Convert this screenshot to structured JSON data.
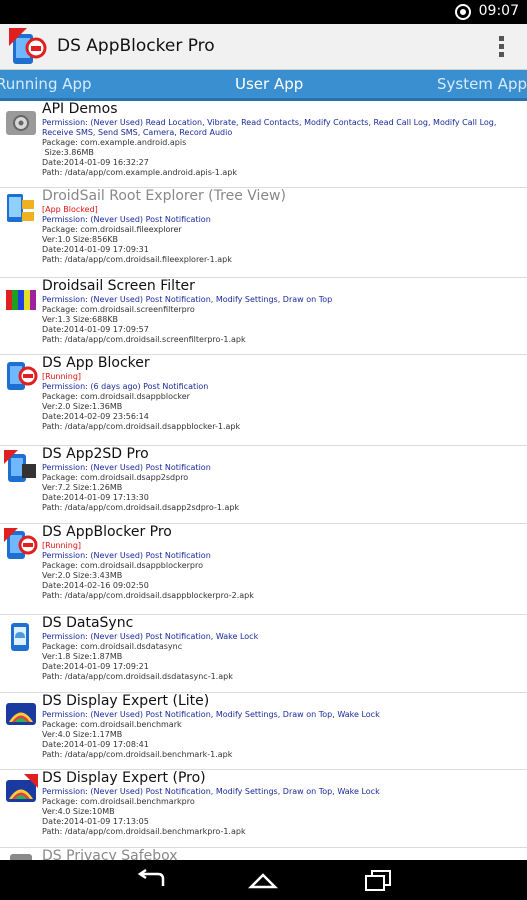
{
  "status_bar": {
    "time": "09:07"
  },
  "app": {
    "title": "DS AppBlocker Pro"
  },
  "tabs": [
    "Running App",
    "User App",
    "System App"
  ],
  "labels": {
    "size": "Size:",
    "date": "Date:"
  },
  "apps": [
    {
      "name": "API Demos",
      "permission": "Permission: (Never Used) Read Location, Vibrate, Read Contacts, Modify Contacts, Read Call Log, Modify Call Log, Receive SMS, Send SMS, Camera, Record Audio",
      "package": "Package: com.example.android.apis",
      "size": "3.86MB",
      "date": "2014-01-09 16:32:27",
      "path": "Path: /data/app/com.example.android.apis-1.apk"
    },
    {
      "name": "DroidSail Root Explorer (Tree View)",
      "status": "[App Blocked]",
      "permission": "Permission: (Never Used) Post Notification",
      "package": "Package: com.droidsail.fileexplorer",
      "ver": "Ver:1.0",
      "size": "856KB",
      "date": "2014-01-09 17:09:31",
      "path": "Path: /data/app/com.droidsail.fileexplorer-1.apk"
    },
    {
      "name": "Droidsail Screen Filter",
      "permission": "Permission: (Never Used) Post Notification, Modify Settings, Draw on Top",
      "package": "Package: com.droidsail.screenfilterpro",
      "ver": "Ver:1.3",
      "size": "688KB",
      "date": "2014-01-09 17:09:57",
      "path": "Path: /data/app/com.droidsail.screenfilterpro-1.apk"
    },
    {
      "name": "DS App Blocker",
      "status": "[Running]",
      "permission": "Permission: (6 days ago) Post Notification",
      "package": "Package: com.droidsail.dsappblocker",
      "ver": "Ver:2.0",
      "size": "1.36MB",
      "date": "2014-02-09 23:56:14",
      "path": "Path: /data/app/com.droidsail.dsappblocker-1.apk"
    },
    {
      "name": "DS App2SD Pro",
      "permission": "Permission: (Never Used) Post Notification",
      "package": "Package: com.droidsail.dsapp2sdpro",
      "ver": "Ver:7.2",
      "size": "1.26MB",
      "date": "2014-01-09 17:13:30",
      "path": "Path: /data/app/com.droidsail.dsapp2sdpro-1.apk"
    },
    {
      "name": "DS AppBlocker Pro",
      "status": "[Running]",
      "permission": "Permission: (Never Used) Post Notification",
      "package": "Package: com.droidsail.dsappblockerpro",
      "ver": "Ver:2.0",
      "size": "3.43MB",
      "date": "2014-02-16 09:02:50",
      "path": "Path: /data/app/com.droidsail.dsappblockerpro-2.apk"
    },
    {
      "name": "DS DataSync",
      "permission": "Permission: (Never Used) Post Notification, Wake Lock",
      "package": "Package: com.droidsail.dsdatasync",
      "ver": "Ver:1.8",
      "size": "1.87MB",
      "date": "2014-01-09 17:09:21",
      "path": "Path: /data/app/com.droidsail.dsdatasync-1.apk"
    },
    {
      "name": "DS Display Expert (Lite)",
      "permission": "Permission: (Never Used) Post Notification, Modify Settings, Draw on Top, Wake Lock",
      "package": "Package: com.droidsail.benchmark",
      "ver": "Ver:4.0",
      "size": "1.17MB",
      "date": "2014-01-09 17:08:41",
      "path": "Path: /data/app/com.droidsail.benchmark-1.apk"
    },
    {
      "name": "DS Display Expert (Pro)",
      "permission": "Permission: (Never Used) Post Notification, Modify Settings, Draw on Top, Wake Lock",
      "package": "Package: com.droidsail.benchmarkpro",
      "ver": "Ver:4.0",
      "size": "10MB",
      "date": "2014-01-09 17:13:05",
      "path": "Path: /data/app/com.droidsail.benchmarkpro-1.apk"
    },
    {
      "name": "DS Privacy Safebox"
    }
  ]
}
